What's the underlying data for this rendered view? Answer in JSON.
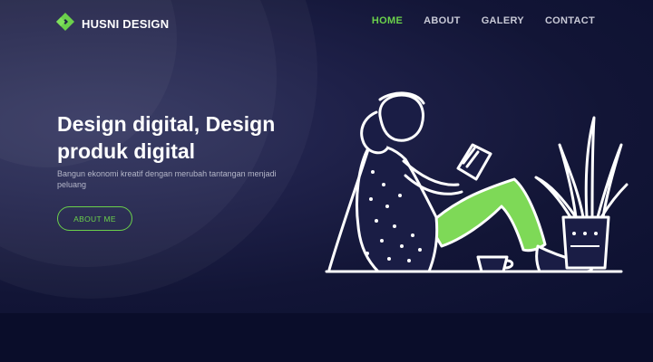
{
  "brand": {
    "name": "HUSNI DESIGN",
    "logo_icon": "diamond-logo-icon",
    "accent": "#6bd14b"
  },
  "nav": {
    "items": [
      {
        "label": "HOME",
        "active": true
      },
      {
        "label": "ABOUT",
        "active": false
      },
      {
        "label": "GALERY",
        "active": false
      },
      {
        "label": "CONTACT",
        "active": false
      }
    ]
  },
  "hero": {
    "headline_line1": "Design digital, Design",
    "headline_line2": "produk digital",
    "subtitle": "Bangun ekonomi kreatif dengan merubah tantangan menjadi peluang",
    "cta_label": "ABOUT ME"
  },
  "illustration": {
    "name": "woman-reading-book-illustration"
  },
  "colors": {
    "background": "#121536",
    "accent": "#6bd14b",
    "text": "#ffffff"
  }
}
